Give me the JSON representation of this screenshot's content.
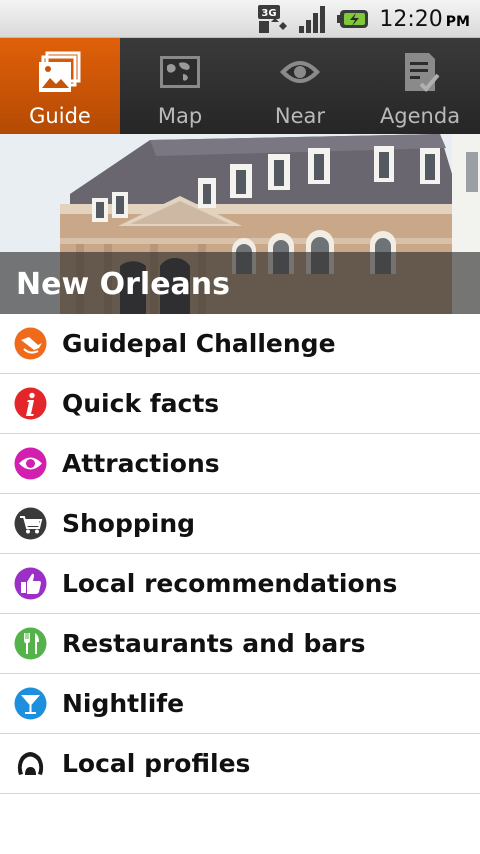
{
  "status_bar": {
    "time": "12:20",
    "ampm": "PM",
    "network": "3G"
  },
  "tabs": [
    {
      "label": "Guide",
      "icon": "guide-icon",
      "active": true
    },
    {
      "label": "Map",
      "icon": "map-icon",
      "active": false
    },
    {
      "label": "Near",
      "icon": "near-eye-icon",
      "active": false
    },
    {
      "label": "Agenda",
      "icon": "agenda-icon",
      "active": false
    }
  ],
  "hero": {
    "title": "New Orleans"
  },
  "menu": [
    {
      "label": "Guidepal Challenge",
      "icon": "challenge-icon",
      "color": "#ef6a1a"
    },
    {
      "label": "Quick facts",
      "icon": "info-icon",
      "color": "#e4262a"
    },
    {
      "label": "Attractions",
      "icon": "eye-icon",
      "color": "#d21fb0"
    },
    {
      "label": "Shopping",
      "icon": "cart-icon",
      "color": "#3a3a3a"
    },
    {
      "label": "Local recommendations",
      "icon": "thumbs-up-icon",
      "color": "#9b2fc6"
    },
    {
      "label": "Restaurants and bars",
      "icon": "fork-knife-icon",
      "color": "#53b24a"
    },
    {
      "label": "Nightlife",
      "icon": "cocktail-icon",
      "color": "#1e8fdc"
    },
    {
      "label": "Local profiles",
      "icon": "profile-icon",
      "color": "#1a1a1a"
    }
  ]
}
